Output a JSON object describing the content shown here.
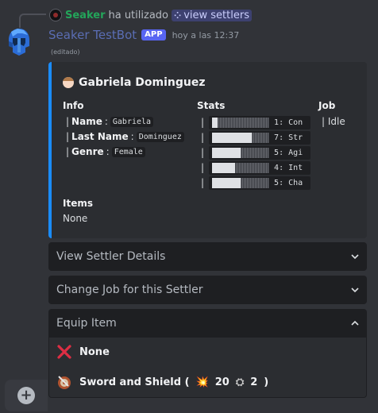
{
  "reply": {
    "user": "Seaker",
    "action": "ha utilizado",
    "command": "view settlers"
  },
  "message": {
    "bot_name": "Seaker TestBot",
    "tag": "APP",
    "timestamp": "hoy a las 12:37",
    "edited": "(editado)"
  },
  "embed": {
    "title": "Gabriela Dominguez",
    "info_label": "Info",
    "info": [
      {
        "bar": "|",
        "key": "Name",
        "value": "Gabriela"
      },
      {
        "bar": "|",
        "key": "Last Name",
        "value": "Dominguez"
      },
      {
        "bar": "|",
        "key": "Genre",
        "value": "Female"
      }
    ],
    "stats_label": "Stats",
    "stats": [
      {
        "bar": "|",
        "fill": 0.1,
        "label": "1: Con"
      },
      {
        "bar": "|",
        "fill": 0.7,
        "label": "7: Str"
      },
      {
        "bar": "|",
        "fill": 0.5,
        "label": "5: Agi"
      },
      {
        "bar": "|",
        "fill": 0.4,
        "label": "4: Int"
      },
      {
        "bar": "|",
        "fill": 0.5,
        "label": "5: Cha"
      }
    ],
    "job_label": "Job",
    "job_value": "| Idle",
    "items_label": "Items",
    "items_value": "None",
    "accent_color": "#1a8cff"
  },
  "selects": {
    "details": "View Settler Details",
    "change_job": "Change Job for this Settler",
    "equip": "Equip Item"
  },
  "equip_options": [
    {
      "icon": "x-mark-icon",
      "label": "None"
    },
    {
      "icon": "sword-shield-icon",
      "label": "Sword and Shield (",
      "dmg": "20",
      "def": "2",
      "close": ")"
    }
  ],
  "composer": {
    "add_icon": "plus-icon",
    "add_glyph": "+"
  }
}
